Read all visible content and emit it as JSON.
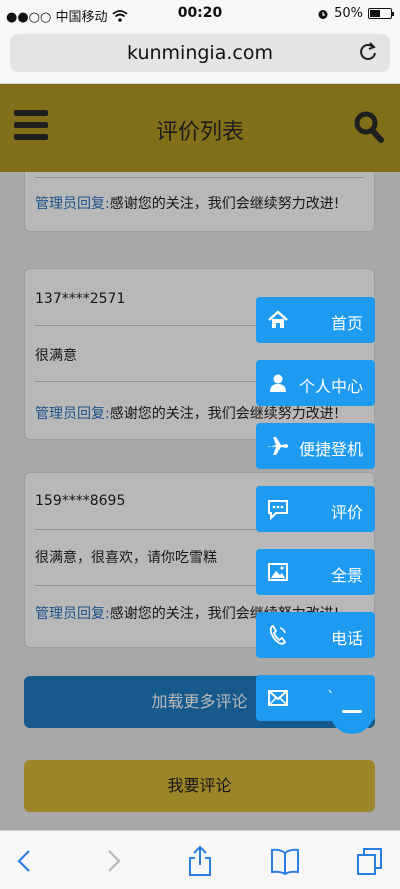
{
  "status_bar": {
    "carrier": "●●○○ 中国移动",
    "time": "00:20",
    "battery": "50%",
    "battery_level": 0.5
  },
  "browser": {
    "url": "kunmingia.com"
  },
  "header": {
    "title": "评价列表"
  },
  "reviews": [
    {
      "reply_label": "管理员回复:",
      "reply_text": "感谢您的关注，我们会继续努力改进!"
    },
    {
      "user": "137****2571",
      "comment": "很满意",
      "reply_label": "管理员回复:",
      "reply_text": "感谢您的关注，我们会继续努力改进!"
    },
    {
      "user": "159****8695",
      "comment": "很满意，很喜欢，请你吃雪糕",
      "reply_label": "管理员回复:",
      "reply_text": "感谢您的关注，我们会继续努力改进!"
    }
  ],
  "buttons": {
    "load_more": "加载更多评论",
    "write_review": "我要评论"
  },
  "float_nav": {
    "items": [
      {
        "label": "首页",
        "icon": "home-icon"
      },
      {
        "label": "个人中心",
        "icon": "user-icon"
      },
      {
        "label": "便捷登机",
        "icon": "airplane-icon"
      },
      {
        "label": "评价",
        "icon": "comment-icon"
      },
      {
        "label": "全景",
        "icon": "image-icon"
      },
      {
        "label": "电话",
        "icon": "phone-icon"
      },
      {
        "label": "`",
        "icon": "mail-icon"
      }
    ]
  },
  "colors": {
    "header": "#b59a23",
    "float_blue": "#1e9bf0",
    "load_more": "#1f7cc4",
    "comment_btn": "#d9b838",
    "admin_text": "#2b74c0"
  }
}
